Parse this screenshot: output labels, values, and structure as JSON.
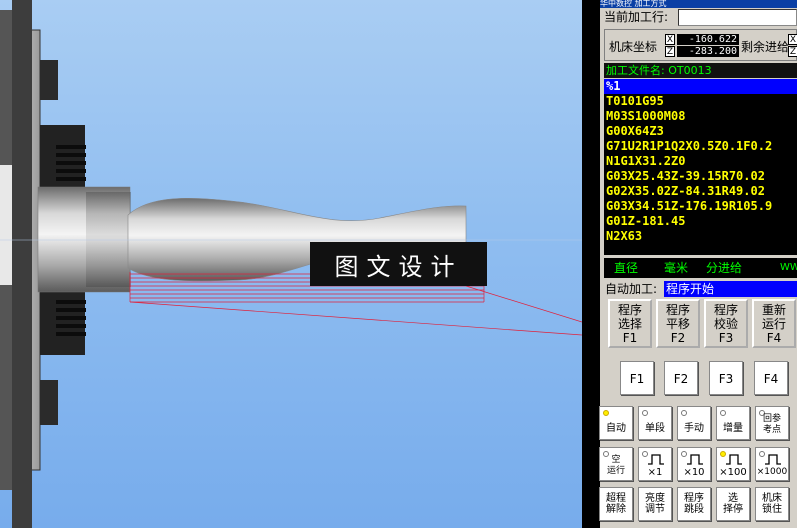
{
  "watermark": "图文设计",
  "panel": {
    "title_partial": "华中数控  加工方式",
    "current_line_label": "当前加工行:",
    "current_line_value": "",
    "coords": {
      "label": "机床坐标",
      "axes": [
        {
          "axis": "X",
          "value": "-160.622"
        },
        {
          "axis": "Z",
          "value": "-283.200"
        }
      ],
      "remain_label": "剩余进给",
      "remain_axes": [
        "X",
        "Z"
      ]
    },
    "file_label": "加工文件名: OT0013",
    "program_lines": [
      "%1",
      "T0101G95",
      "M03S1000M08",
      "G00X64Z3",
      "G71U2R1P1Q2X0.5Z0.1F0.2",
      "N1G1X31.2Z0",
      "G03X25.43Z-39.15R70.02",
      "G02X35.02Z-84.31R49.02",
      "G03X34.51Z-176.19R105.9",
      "G01Z-181.45",
      "N2X63"
    ],
    "mode_bar": [
      "直径",
      "毫米",
      "分进给",
      "WWW"
    ],
    "auto_label": "自动加工:",
    "auto_status": "程序开始",
    "soft_buttons": [
      {
        "l1": "程序",
        "l2": "选择",
        "key": "F1"
      },
      {
        "l1": "程序",
        "l2": "平移",
        "key": "F2"
      },
      {
        "l1": "程序",
        "l2": "校验",
        "key": "F3"
      },
      {
        "l1": "重新",
        "l2": "运行",
        "key": "F4"
      }
    ],
    "fkeys": [
      "F1",
      "F2",
      "F3",
      "F4"
    ],
    "mode_buttons": [
      {
        "label": "自动",
        "led_on": true
      },
      {
        "label": "单段",
        "led_on": false
      },
      {
        "label": "手动",
        "led_on": false
      },
      {
        "label": "增量",
        "led_on": false
      },
      {
        "label": "回参考点",
        "led_on": false
      }
    ],
    "step_buttons": [
      {
        "label": "空运行",
        "led_on": false
      },
      {
        "label": "×1",
        "led_on": false
      },
      {
        "label": "×10",
        "led_on": false
      },
      {
        "label": "×100",
        "led_on": true
      },
      {
        "label": "×1000",
        "led_on": false
      }
    ],
    "misc_buttons": [
      "超程解除",
      "亮度调节",
      "程序跳段",
      "选择停",
      "机床锁住"
    ]
  },
  "colors": {
    "program_text": "#ffff00",
    "selected_line_bg": "#0000ff",
    "mode_text": "#00ff00",
    "led_on": "#ffee00"
  }
}
